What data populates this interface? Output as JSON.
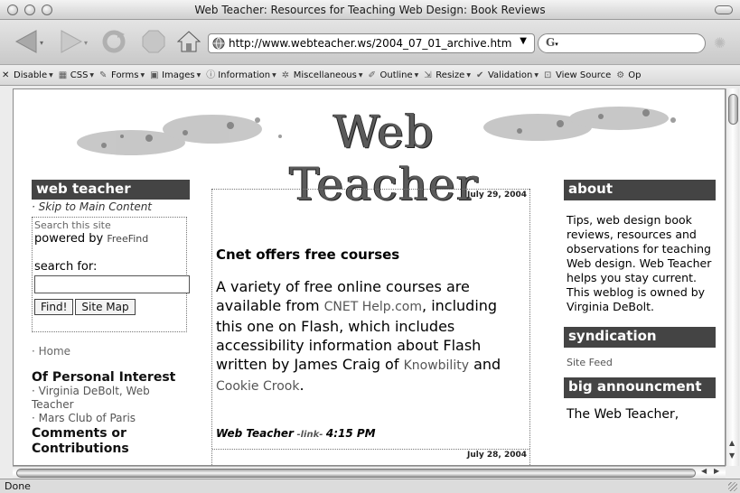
{
  "window": {
    "title": "Web Teacher: Resources for Teaching Web Design: Book Reviews"
  },
  "nav": {
    "url": "http://www.webteacher.ws/2004_07_01_archive.htm",
    "search_value": "G"
  },
  "devbar": {
    "items": [
      "Disable",
      "CSS",
      "Forms",
      "Images",
      "Information",
      "Miscellaneous",
      "Outline",
      "Resize",
      "Validation",
      "View Source",
      "Op"
    ]
  },
  "page": {
    "banner_title": "Web Teacher",
    "left": {
      "heading": "web teacher",
      "skip": "· Skip to Main Content",
      "search_site": "Search this site",
      "powered_by": "powered by",
      "freefind": "FreeFind",
      "search_for": "search for:",
      "find_button": "Find!",
      "sitemap_button": "Site Map",
      "home": "· Home",
      "interest_heading": "Of Personal Interest",
      "link1": "· Virginia DeBolt, Web Teacher",
      "link2": "· Mars Club of Paris",
      "comments_heading": "Comments or Contributions"
    },
    "main": {
      "date1": "July 29, 2004",
      "post_title": "Cnet offers free courses",
      "body_1": "A variety of free online courses are available from",
      "link_cnet": "CNET Help.com",
      "body_2": ", including this one on Flash, which includes accessibility information about Flash written by James Craig of",
      "link_knowbility": "Knowbility",
      "body_3": " and",
      "link_cookie": "Cookie Crook",
      "body_4": ".",
      "byline_author": "Web Teacher",
      "byline_link": " -link- ",
      "byline_time": "4:15 PM",
      "date2": "July 28, 2004"
    },
    "right": {
      "about_heading": "about",
      "about_text": "Tips, web design book reviews, resources and observations for teaching Web design. Web Teacher helps you stay current. This weblog is owned by Virginia DeBolt.",
      "syndication_heading": "syndication",
      "site_feed": "Site Feed",
      "announce_heading": "big announcment",
      "announce_text": "The Web Teacher,"
    }
  },
  "status": {
    "text": "Done"
  }
}
